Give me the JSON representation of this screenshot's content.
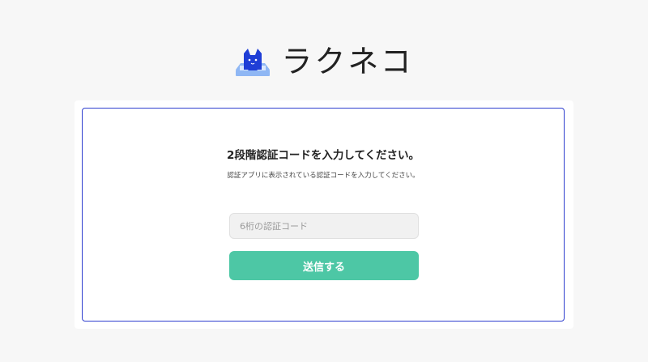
{
  "brand": {
    "name": "ラクネコ",
    "logo_icon": "cat-on-tray-icon",
    "colors": {
      "cat": "#1f3ed6",
      "tray": "#8fb7f4"
    }
  },
  "auth": {
    "title": "2段階認証コードを入力してください。",
    "subtitle": "認証アプリに表示されている認証コードを入力してください。",
    "code_placeholder": "6桁の認証コード",
    "code_value": "",
    "submit_label": "送信する"
  },
  "colors": {
    "page_background": "#f7f7f7",
    "card_border": "#2f3fcf",
    "submit_button": "#4dc7a5"
  }
}
